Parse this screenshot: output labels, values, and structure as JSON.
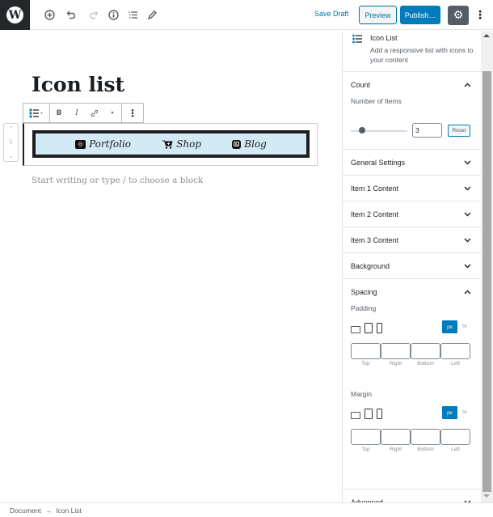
{
  "topbar": {
    "logo": "W",
    "icons": [
      "add-block-icon",
      "undo-icon",
      "redo-icon",
      "info-icon",
      "list-view-icon",
      "edit-tools-icon"
    ],
    "save_draft": "Save Draft",
    "preview": "Preview",
    "publish": "Publish…",
    "settings_icon": "⚙",
    "more_icon": "⋮"
  },
  "editor": {
    "title": "Icon list",
    "toolbar": {
      "block_type_icon": "☰",
      "bold": "B",
      "italic": "I",
      "link": "🔗",
      "more_format": "▾",
      "options": "⋮"
    },
    "mover": {
      "up": "⌃",
      "drag": "⠿",
      "down": "⌄"
    },
    "icon_list": {
      "background": "#d3eaf5",
      "border_color": "#1c1e20",
      "items": [
        {
          "icon": "camera-icon",
          "glyph": "◎",
          "label": "Portfolio"
        },
        {
          "icon": "cart-icon",
          "glyph": "🛒",
          "label": "Shop"
        },
        {
          "icon": "blogger-icon",
          "glyph": "B",
          "label": "Blog"
        }
      ]
    },
    "placeholder": "Start writing or type / to choose a block"
  },
  "sidebar": {
    "block": {
      "name": "Icon List",
      "description": "Add a responsive list with icons to your content"
    },
    "count_panel": {
      "title": "Count",
      "field_label": "Number of Items",
      "value": "3",
      "slider_fraction": 0.2,
      "reset": "Reset"
    },
    "collapsed_panels": [
      "General Settings",
      "Item 1 Content",
      "Item 2 Content",
      "Item 3 Content",
      "Background"
    ],
    "spacing_panel": {
      "title": "Spacing",
      "padding_label": "Padding",
      "margin_label": "Margin",
      "unit_px": "px",
      "unit_pct": "%",
      "sides": [
        "Top",
        "Right",
        "Bottom",
        "Left"
      ]
    },
    "advanced_panel": {
      "title": "Advanced"
    }
  },
  "footer": {
    "breadcrumb": [
      "Document",
      "Icon List"
    ],
    "separator": "→"
  },
  "colors": {
    "accent": "#007cba",
    "dark": "#23282d",
    "settings_bg": "#555d66"
  }
}
